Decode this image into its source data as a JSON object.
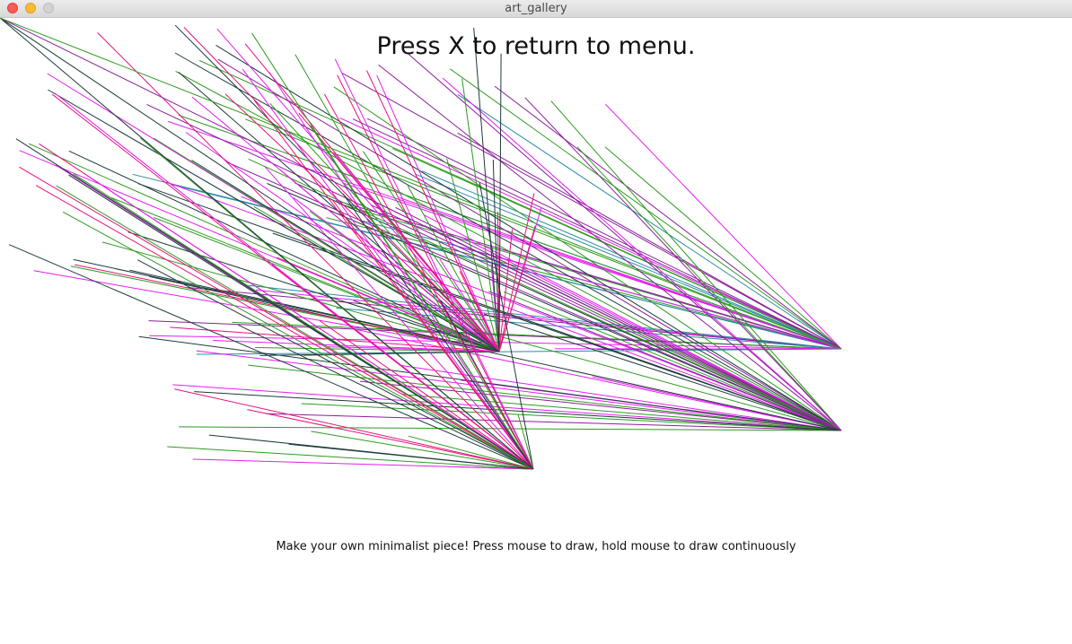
{
  "window": {
    "title": "art_gallery"
  },
  "heading": "Press X to return to menu.",
  "instructions": "Make your own minimalist piece! Press mouse to draw, hold mouse to draw continuously",
  "colors": {
    "background": "#ffffff",
    "magenta": "#e21ef0",
    "pink": "#e6127a",
    "green": "#2e9a20",
    "teal": "#2a8aa6",
    "dark": "#1d3a3a",
    "purple": "#8a1f9a"
  }
}
